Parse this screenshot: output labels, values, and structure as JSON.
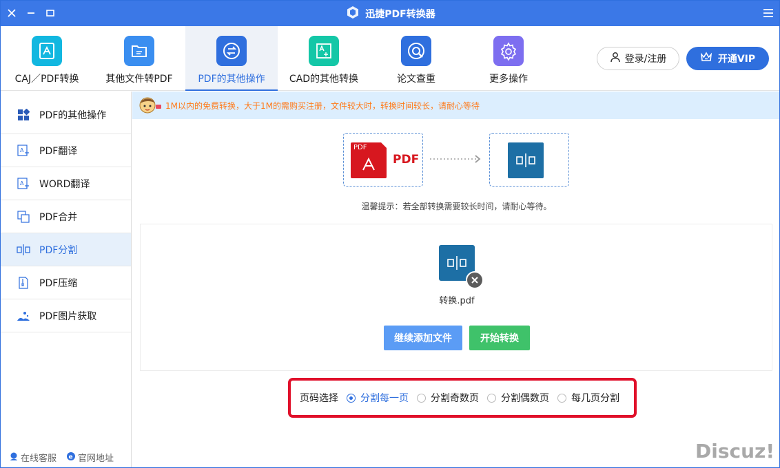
{
  "app": {
    "title": "迅捷PDF转换器"
  },
  "toolbar": {
    "tools": [
      {
        "label": "CAJ／PDF转换",
        "icon": "pdf-convert-icon",
        "color": "#12b7e0"
      },
      {
        "label": "其他文件转PDF",
        "icon": "folder-icon",
        "color": "#3a8ef0"
      },
      {
        "label": "PDF的其他操作",
        "icon": "swap-arrows-icon",
        "color": "#2f6fde"
      },
      {
        "label": "CAD的其他转换",
        "icon": "cad-icon",
        "color": "#14c7a7"
      },
      {
        "label": "论文查重",
        "icon": "check-search-icon",
        "color": "#2f6fde"
      },
      {
        "label": "更多操作",
        "icon": "gear-icon",
        "color": "#7d6ef0"
      }
    ],
    "active_index": 2,
    "login_label": "登录/注册",
    "vip_label": "开通VIP"
  },
  "sidebar": {
    "items": [
      {
        "label": "PDF的其他操作",
        "icon": "grid-icon"
      },
      {
        "label": "PDF翻译",
        "icon": "translate-icon"
      },
      {
        "label": "WORD翻译",
        "icon": "translate-icon"
      },
      {
        "label": "PDF合并",
        "icon": "merge-icon"
      },
      {
        "label": "PDF分割",
        "icon": "split-icon"
      },
      {
        "label": "PDF压缩",
        "icon": "compress-icon"
      },
      {
        "label": "PDF图片获取",
        "icon": "image-extract-icon"
      }
    ],
    "active_index": 4,
    "footer": {
      "service_label": "在线客服",
      "website_label": "官网地址"
    }
  },
  "notice": {
    "text": "1M以内的免费转换，大于1M的需购买注册，文件较大时，转换时间较长，请耐心等待"
  },
  "flow": {
    "source_label": "PDF",
    "badge_label": "PDF"
  },
  "tip": {
    "text": "温馨提示：若全部转换需要较长时间，请耐心等待。"
  },
  "file": {
    "name": "转换.pdf"
  },
  "actions": {
    "add_label": "继续添加文件",
    "start_label": "开始转换"
  },
  "page_select": {
    "label": "页码选择",
    "options": [
      "分割每一页",
      "分割奇数页",
      "分割偶数页",
      "每几页分割"
    ],
    "selected_index": 0
  },
  "watermark": {
    "text": "Discuz!"
  },
  "colors": {
    "accent": "#2f6fde",
    "notice": "#ff7a1a",
    "highlight": "#e0102a"
  }
}
